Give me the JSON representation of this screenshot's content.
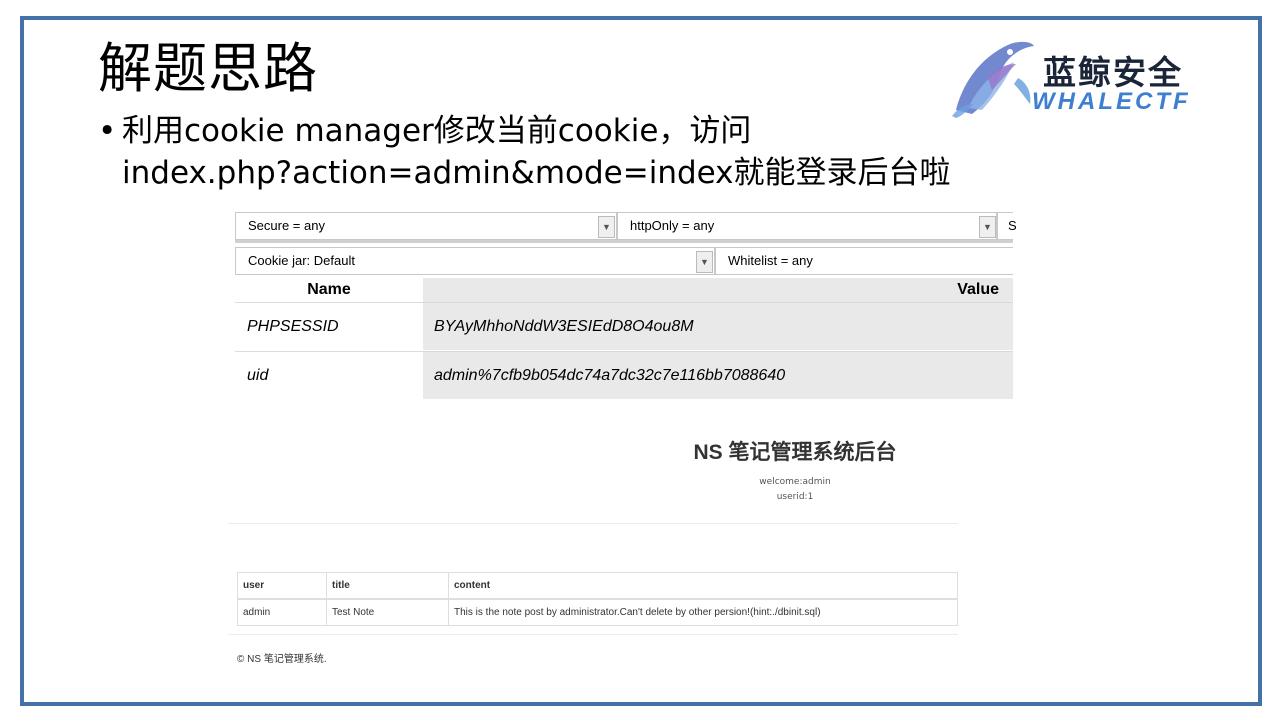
{
  "slide": {
    "title": "解题思路",
    "bullet_line1": "利用cookie manager修改当前cookie，访问",
    "bullet_line2": "index.php?action=admin&mode=index就能登录后台啦"
  },
  "logo": {
    "cn": "蓝鲸安全",
    "en": "WHALECTF"
  },
  "cookie_manager": {
    "filter_secure": "Secure = any",
    "filter_httponly": "httpOnly = any",
    "filter_cookiejar": "Cookie jar: Default",
    "filter_whitelist": "Whitelist = any",
    "col_name": "Name",
    "col_value": "Value",
    "rows": [
      {
        "name": "PHPSESSID",
        "value": "BYAyMhhoNddW3ESIEdD8O4ou8M"
      },
      {
        "name": "uid",
        "value": "admin%7cfb9b054dc74a7dc32c7e116bb7088640"
      }
    ]
  },
  "backend": {
    "title": "NS 笔记管理系统后台",
    "welcome": "welcome:admin",
    "userid": "userid:1",
    "table_headers": [
      "user",
      "title",
      "content"
    ],
    "table_rows": [
      [
        "admin",
        "Test Note",
        "This is the note post by administrator.Can't delete by other persion!(hint:./dbinit.sql)"
      ]
    ],
    "footer": "© NS 笔记管理系统."
  },
  "colors": {
    "frame": "#4472a8",
    "logo_en": "#3e7fd0",
    "cell_bg": "#e9e9e9"
  }
}
